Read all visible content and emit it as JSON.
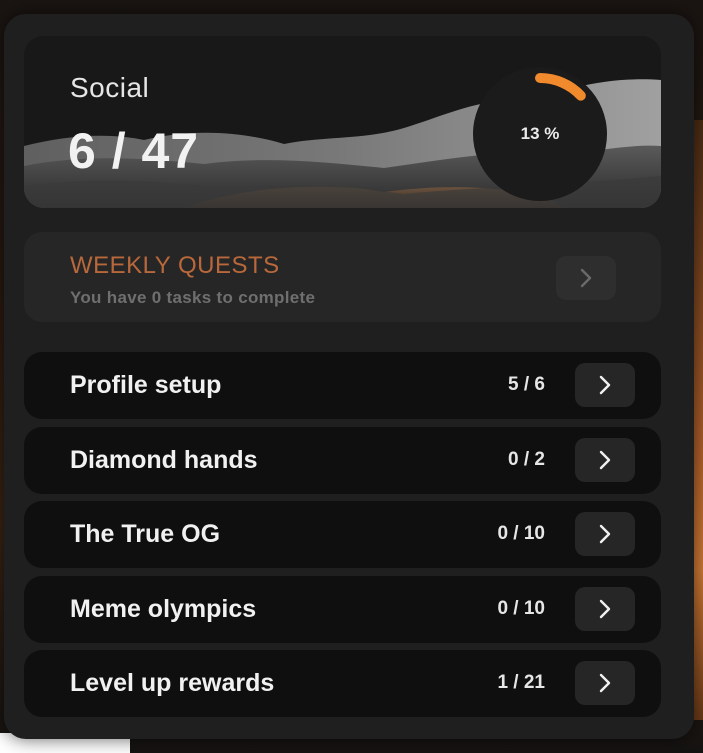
{
  "social": {
    "label": "Social",
    "count": "6 / 47",
    "progress_text": "13 %",
    "progress_fraction": 0.13,
    "accent_color": "#f08a2c"
  },
  "weekly": {
    "title": "WEEKLY QUESTS",
    "subtitle": "You have 0 tasks to complete",
    "title_color": "#b8683a",
    "button_icon": "chevron-right-icon"
  },
  "quests": [
    {
      "label": "Profile setup",
      "count": "5 / 6",
      "button_icon": "chevron-right-icon"
    },
    {
      "label": "Diamond hands",
      "count": "0 / 2",
      "button_icon": "chevron-right-icon"
    },
    {
      "label": "The True OG",
      "count": "0 / 10",
      "button_icon": "chevron-right-icon"
    },
    {
      "label": "Meme olympics",
      "count": "0 / 10",
      "button_icon": "chevron-right-icon"
    },
    {
      "label": "Level up rewards",
      "count": "1 / 21",
      "button_icon": "chevron-right-icon"
    }
  ]
}
